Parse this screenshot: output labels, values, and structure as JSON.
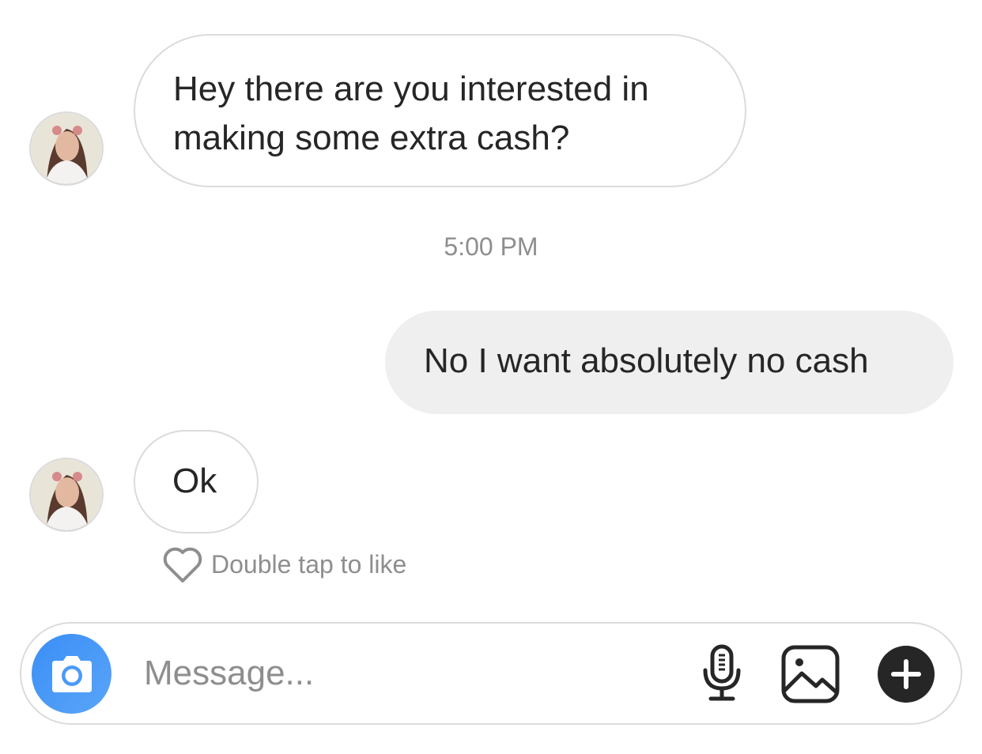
{
  "messages": [
    {
      "sender": "them",
      "lines": [
        "Hey there are you interested in",
        "making some extra cash?"
      ]
    },
    {
      "timestamp": "5:00 PM"
    },
    {
      "sender": "me",
      "text": "No I want absolutely no cash"
    },
    {
      "sender": "them",
      "text": "Ok"
    }
  ],
  "like_hint": "Double tap to like",
  "composer": {
    "placeholder": "Message...",
    "icons": {
      "camera": "camera-icon",
      "mic": "microphone-icon",
      "gallery": "image-icon",
      "more": "plus-icon"
    }
  },
  "colors": {
    "accent": "#3a8ef6",
    "bubble_out_bg": "#efefef",
    "border": "#dbdbdb",
    "muted_text": "#8e8e8e",
    "text": "#262626"
  }
}
